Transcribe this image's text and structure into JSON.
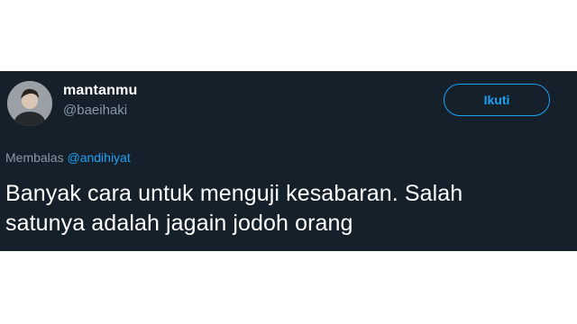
{
  "tweet": {
    "user": {
      "display_name": "mantanmu",
      "handle": "@baeihaki",
      "avatar_icon": "profile-photo"
    },
    "follow_button_label": "Ikuti",
    "reply_prefix": "Membalas",
    "reply_mention": "@andihiyat",
    "text_line1": "Banyak cara untuk menguji kesabaran. Salah",
    "text_line2": "satunya adalah jagain jodoh orang"
  },
  "colors": {
    "card_background": "#15202b",
    "accent": "#1da1f2",
    "secondary_text": "#8899a6"
  }
}
